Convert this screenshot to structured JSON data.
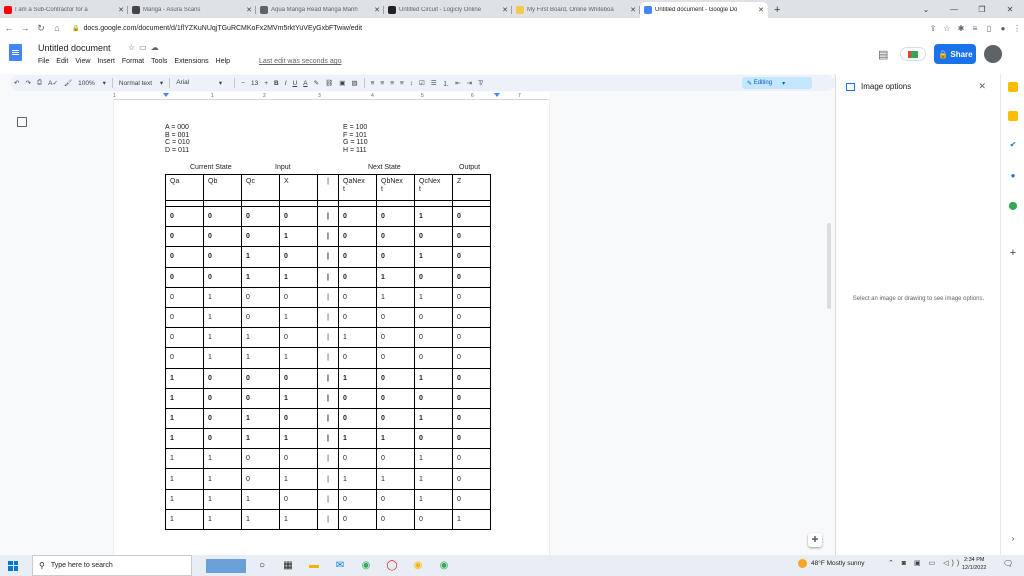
{
  "browser": {
    "tabs": [
      {
        "title": "I am a Sub-Contractor for a",
        "icon": "youtube-icon",
        "color": "#ff0000"
      },
      {
        "title": "Manga - Asura Scans",
        "icon": "asura-icon",
        "color": "#444444"
      },
      {
        "title": "Aqua Manga Read Manga Manh",
        "icon": "aqua-manga-icon",
        "color": "#5f6368"
      },
      {
        "title": "Untitled Circuit - Logicly Online",
        "icon": "logicly-icon",
        "color": "#202124"
      },
      {
        "title": "My First Board, Online Whiteboa",
        "icon": "miro-icon",
        "color": "#f2c94c"
      },
      {
        "title": "Untitled document - Google Do",
        "icon": "docs-icon",
        "color": "#4285f4"
      }
    ],
    "url": "docs.google.com/document/d/1flYZKuNUqjTGuRCMKoFx2MVm5rktYuVEyGxbFTwiw/edit"
  },
  "doc": {
    "title": "Untitled document",
    "menus": [
      "File",
      "Edit",
      "View",
      "Insert",
      "Format",
      "Tools",
      "Extensions",
      "Help"
    ],
    "last_edit": "Last edit was seconds ago",
    "share_label": "Share"
  },
  "toolbar": {
    "zoom": "100%",
    "style": "Normal text",
    "font": "Arial",
    "size": "13",
    "mode": "Editing"
  },
  "ruler": [
    "1",
    "1",
    "2",
    "3",
    "4",
    "5",
    "6",
    "7"
  ],
  "codes_left": [
    "A = 000",
    "B = 001",
    "C = 010",
    "D = 011"
  ],
  "codes_right": [
    "E = 100",
    "F = 101",
    "G = 110",
    "H = 111"
  ],
  "table": {
    "group_labels": {
      "current": "Current State",
      "input": "Input",
      "next": "Next State",
      "output": "Output"
    },
    "headers": [
      "Qa",
      "Qb",
      "Qc",
      "X",
      "|",
      "QaNex\nt",
      "QbNex\nt",
      "QcNex\nt",
      "Z"
    ],
    "rows": [
      {
        "bold": true,
        "cells": [
          "0",
          "0",
          "0",
          "0",
          "|",
          "0",
          "0",
          "1",
          "0"
        ]
      },
      {
        "bold": true,
        "cells": [
          "0",
          "0",
          "0",
          "1",
          "|",
          "0",
          "0",
          "0",
          "0"
        ]
      },
      {
        "bold": true,
        "cells": [
          "0",
          "0",
          "1",
          "0",
          "|",
          "0",
          "0",
          "1",
          "0"
        ]
      },
      {
        "bold": true,
        "cells": [
          "0",
          "0",
          "1",
          "1",
          "|",
          "0",
          "1",
          "0",
          "0"
        ]
      },
      {
        "bold": false,
        "cells": [
          "0",
          "1",
          "0",
          "0",
          "|",
          "0",
          "1",
          "1",
          "0"
        ]
      },
      {
        "bold": false,
        "cells": [
          "0",
          "1",
          "0",
          "1",
          "|",
          "0",
          "0",
          "0",
          "0"
        ]
      },
      {
        "bold": false,
        "cells": [
          "0",
          "1",
          "1",
          "0",
          "|",
          "1",
          "0",
          "0",
          "0"
        ]
      },
      {
        "bold": false,
        "cells": [
          "0",
          "1",
          "1",
          "1",
          "|",
          "0",
          "0",
          "0",
          "0"
        ]
      },
      {
        "bold": true,
        "cells": [
          "1",
          "0",
          "0",
          "0",
          "|",
          "1",
          "0",
          "1",
          "0"
        ]
      },
      {
        "bold": true,
        "cells": [
          "1",
          "0",
          "0",
          "1",
          "|",
          "0",
          "0",
          "0",
          "0"
        ]
      },
      {
        "bold": true,
        "cells": [
          "1",
          "0",
          "1",
          "0",
          "|",
          "0",
          "0",
          "1",
          "0"
        ]
      },
      {
        "bold": true,
        "cells": [
          "1",
          "0",
          "1",
          "1",
          "|",
          "1",
          "1",
          "0",
          "0"
        ]
      },
      {
        "bold": false,
        "cells": [
          "1",
          "1",
          "0",
          "0",
          "|",
          "0",
          "0",
          "1",
          "0"
        ]
      },
      {
        "bold": false,
        "cells": [
          "1",
          "1",
          "0",
          "1",
          "|",
          "1",
          "1",
          "1",
          "0"
        ]
      },
      {
        "bold": false,
        "cells": [
          "1",
          "1",
          "1",
          "0",
          "|",
          "0",
          "0",
          "1",
          "0"
        ]
      },
      {
        "bold": false,
        "cells": [
          "1",
          "1",
          "1",
          "1",
          "|",
          "0",
          "0",
          "0",
          "1"
        ]
      }
    ]
  },
  "side_panel": {
    "title": "Image options",
    "message": "Select an image or drawing to see image options."
  },
  "taskbar": {
    "search_placeholder": "Type here to search",
    "weather": "48°F  Mostly sunny",
    "time": "2:34 PM",
    "date": "12/1/2022"
  }
}
